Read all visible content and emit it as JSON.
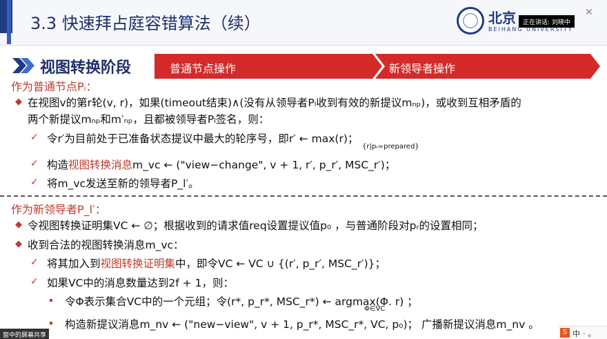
{
  "header": {
    "title": "3.3 快速拜占庭容错算法（续）",
    "university_name": "北京",
    "university_sub": "BEIHANG UNIVERSITY",
    "speaker_status": "正在讲话: 刘晓中"
  },
  "phase": {
    "title": "视图转换阶段",
    "tab1": "普通节点操作",
    "tab2": "新领导者操作"
  },
  "section1": {
    "heading": "作为普通节点Pᵢ：",
    "item1_line1": "在视图v的第r轮(v, r)，如果(timeout结束)∧(没有从领导者Pₗ收到有效的新提议mₙₚ)，或收到互相矛盾的",
    "item1_line2": "两个新提议mₙₚ和m′ₙₚ，且都被领导者Pₗ签名，则：",
    "sub1": "令r′为目前处于已准备状态提议中最大的轮序号，即r′ ← max(r)；",
    "sub1_under": "{r|pᵣ=prepared}",
    "sub2_pre": "构造",
    "sub2_red": "视图转换消息",
    "sub2_post": "m_vc ← (\"view−change\", v + 1, r′, p_r′, MSC_r′)；",
    "sub3": "将m_vc发送至新的领导者P_l′。"
  },
  "section2": {
    "heading": "作为新领导者P_l′：",
    "item1": "令视图转换证明集VC ← ∅；根据收到的请求值req设置提议值p₀ ，与普通阶段对pᵣ的设置相同；",
    "item2": "收到合法的视图转换消息m_vc：",
    "sub1_pre": "将其加入到",
    "sub1_red": "视图转换证明集",
    "sub1_post": "中，即令VC ← VC ∪ {(r′, p_r′, MSC_r′)}；",
    "sub2": "如果VC中的消息数量达到2f + 1，则：",
    "sub2a": "令Φ表示集合VC中的一个元组；令(r*, p_r*, MSC_r*) ← argmax(Φ. r) ；",
    "sub2a_under": "Φ∈VC",
    "sub2b": "构造新提议消息m_nv ← (\"new−view\", v + 1, p_r*, MSC_r*, VC, p₀)； 广播新提议消息m_nv 。"
  },
  "footer": {
    "share_tag": "窗中的屏幕共享",
    "ime_letter": "S",
    "ime_text": "中·。"
  },
  "colors": {
    "accent_red": "#c0392b",
    "bar_red": "#d42a2a",
    "navy": "#1f2f6b"
  }
}
